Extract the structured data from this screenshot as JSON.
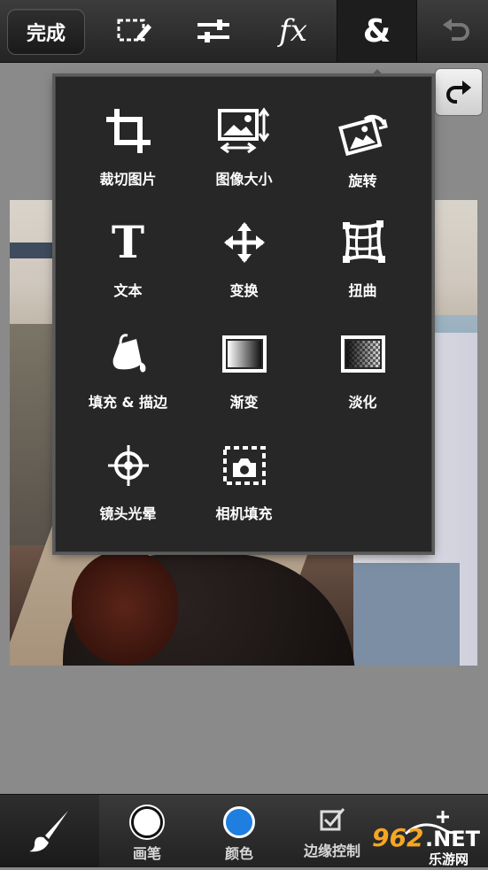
{
  "toolbar": {
    "done_label": "完成",
    "icons": [
      "selection-edit-icon",
      "adjust-sliders-icon",
      "fx-icon",
      "ampersand-icon",
      "undo-icon"
    ],
    "fx_glyph": "fx",
    "amp_glyph": "&"
  },
  "menu": {
    "items": [
      {
        "label": "裁切图片",
        "icon": "crop-icon"
      },
      {
        "label": "图像大小",
        "icon": "image-size-icon"
      },
      {
        "label": "旋转",
        "icon": "rotate-icon"
      },
      {
        "label": "文本",
        "icon": "text-icon"
      },
      {
        "label": "变换",
        "icon": "transform-icon"
      },
      {
        "label": "扭曲",
        "icon": "distort-icon"
      },
      {
        "label": "填充 & 描边",
        "icon": "fill-stroke-icon"
      },
      {
        "label": "渐变",
        "icon": "gradient-icon"
      },
      {
        "label": "淡化",
        "icon": "fade-icon"
      },
      {
        "label": "镜头光晕",
        "icon": "lens-flare-icon"
      },
      {
        "label": "相机填充",
        "icon": "camera-fill-icon"
      }
    ],
    "text_glyph": "T"
  },
  "bottom": {
    "brush_icon": "brush-icon",
    "pen_label": "画笔",
    "color_label": "颜色",
    "edge_label": "边缘控制",
    "color_value": "#1e7fe0"
  },
  "watermark": {
    "text_num": "962",
    "text_net": ".NET",
    "text_cn": "乐游网"
  }
}
